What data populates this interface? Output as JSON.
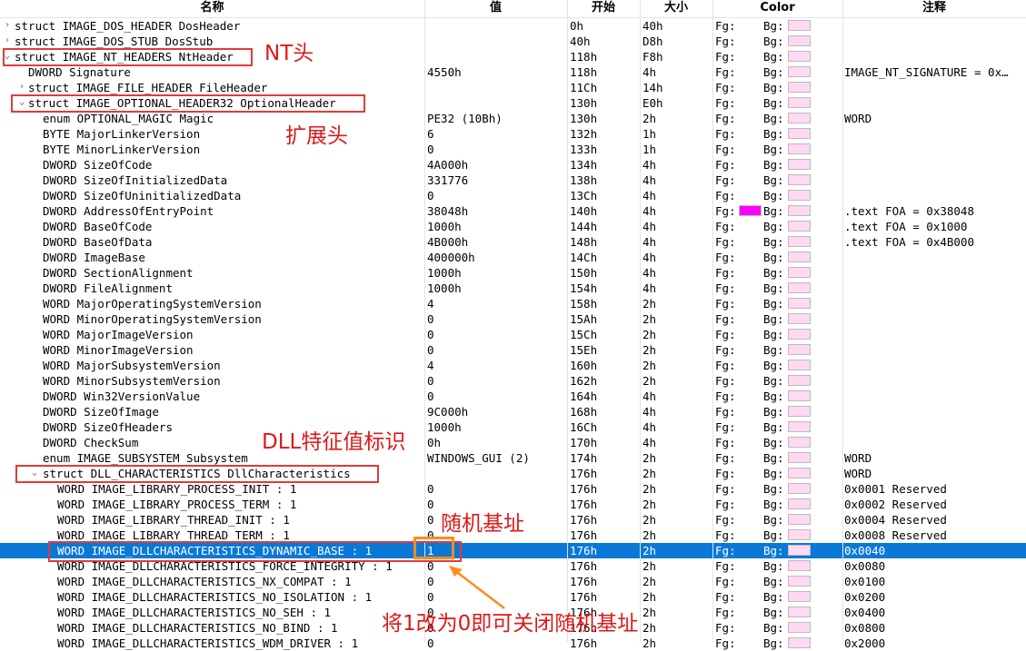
{
  "columns": {
    "name": "名称",
    "value": "值",
    "start": "开始",
    "size": "大小",
    "color": "Color",
    "comment": "注释"
  },
  "colors": {
    "bg_swatch": "#ffd9f2",
    "fg_swatch_magenta": "#ff00ff",
    "selection": "#0a78d7",
    "annotation_red": "#e01818",
    "annotation_orange": "#ff8c1a"
  },
  "rows": [
    {
      "name": "struct IMAGE_DOS_HEADER DosHeader",
      "value": "",
      "start": "0h",
      "size": "40h",
      "fg": "Fg:",
      "bg": "Bg:",
      "comment": "",
      "indent": 0,
      "expander": "collapsed"
    },
    {
      "name": "struct IMAGE_DOS_STUB DosStub",
      "value": "",
      "start": "40h",
      "size": "D8h",
      "fg": "Fg:",
      "bg": "Bg:",
      "comment": "",
      "indent": 0,
      "expander": "collapsed"
    },
    {
      "name": "struct IMAGE_NT_HEADERS NtHeader",
      "value": "",
      "start": "118h",
      "size": "F8h",
      "fg": "Fg:",
      "bg": "Bg:",
      "comment": "",
      "indent": 0,
      "expander": "expanded"
    },
    {
      "name": "DWORD Signature",
      "value": "4550h",
      "start": "118h",
      "size": "4h",
      "fg": "Fg:",
      "bg": "Bg:",
      "comment": "IMAGE_NT_SIGNATURE = 0x…",
      "indent": 1,
      "expander": ""
    },
    {
      "name": "struct IMAGE_FILE_HEADER FileHeader",
      "value": "",
      "start": "11Ch",
      "size": "14h",
      "fg": "Fg:",
      "bg": "Bg:",
      "comment": "",
      "indent": 1,
      "expander": "collapsed"
    },
    {
      "name": "struct IMAGE_OPTIONAL_HEADER32 OptionalHeader",
      "value": "",
      "start": "130h",
      "size": "E0h",
      "fg": "Fg:",
      "bg": "Bg:",
      "comment": "",
      "indent": 1,
      "expander": "expanded"
    },
    {
      "name": "enum OPTIONAL_MAGIC Magic",
      "value": "PE32 (10Bh)",
      "start": "130h",
      "size": "2h",
      "fg": "Fg:",
      "bg": "Bg:",
      "comment": "WORD",
      "indent": 2,
      "expander": ""
    },
    {
      "name": "BYTE MajorLinkerVersion",
      "value": "6",
      "start": "132h",
      "size": "1h",
      "fg": "Fg:",
      "bg": "Bg:",
      "comment": "",
      "indent": 2,
      "expander": ""
    },
    {
      "name": "BYTE MinorLinkerVersion",
      "value": "0",
      "start": "133h",
      "size": "1h",
      "fg": "Fg:",
      "bg": "Bg:",
      "comment": "",
      "indent": 2,
      "expander": ""
    },
    {
      "name": "DWORD SizeOfCode",
      "value": "4A000h",
      "start": "134h",
      "size": "4h",
      "fg": "Fg:",
      "bg": "Bg:",
      "comment": "",
      "indent": 2,
      "expander": ""
    },
    {
      "name": "DWORD SizeOfInitializedData",
      "value": "331776",
      "start": "138h",
      "size": "4h",
      "fg": "Fg:",
      "bg": "Bg:",
      "comment": "",
      "indent": 2,
      "expander": ""
    },
    {
      "name": "DWORD SizeOfUninitializedData",
      "value": "0",
      "start": "13Ch",
      "size": "4h",
      "fg": "Fg:",
      "bg": "Bg:",
      "comment": "",
      "indent": 2,
      "expander": ""
    },
    {
      "name": "DWORD AddressOfEntryPoint",
      "value": "38048h",
      "start": "140h",
      "size": "4h",
      "fg": "Fg:",
      "bg": "Bg:",
      "comment": ".text FOA = 0x38048",
      "indent": 2,
      "expander": "",
      "fg_swatch": true
    },
    {
      "name": "DWORD BaseOfCode",
      "value": "1000h",
      "start": "144h",
      "size": "4h",
      "fg": "Fg:",
      "bg": "Bg:",
      "comment": ".text FOA = 0x1000",
      "indent": 2,
      "expander": ""
    },
    {
      "name": "DWORD BaseOfData",
      "value": "4B000h",
      "start": "148h",
      "size": "4h",
      "fg": "Fg:",
      "bg": "Bg:",
      "comment": ".text FOA = 0x4B000",
      "indent": 2,
      "expander": ""
    },
    {
      "name": "DWORD ImageBase",
      "value": "400000h",
      "start": "14Ch",
      "size": "4h",
      "fg": "Fg:",
      "bg": "Bg:",
      "comment": "",
      "indent": 2,
      "expander": ""
    },
    {
      "name": "DWORD SectionAlignment",
      "value": "1000h",
      "start": "150h",
      "size": "4h",
      "fg": "Fg:",
      "bg": "Bg:",
      "comment": "",
      "indent": 2,
      "expander": ""
    },
    {
      "name": "DWORD FileAlignment",
      "value": "1000h",
      "start": "154h",
      "size": "4h",
      "fg": "Fg:",
      "bg": "Bg:",
      "comment": "",
      "indent": 2,
      "expander": ""
    },
    {
      "name": "WORD MajorOperatingSystemVersion",
      "value": "4",
      "start": "158h",
      "size": "2h",
      "fg": "Fg:",
      "bg": "Bg:",
      "comment": "",
      "indent": 2,
      "expander": ""
    },
    {
      "name": "WORD MinorOperatingSystemVersion",
      "value": "0",
      "start": "15Ah",
      "size": "2h",
      "fg": "Fg:",
      "bg": "Bg:",
      "comment": "",
      "indent": 2,
      "expander": ""
    },
    {
      "name": "WORD MajorImageVersion",
      "value": "0",
      "start": "15Ch",
      "size": "2h",
      "fg": "Fg:",
      "bg": "Bg:",
      "comment": "",
      "indent": 2,
      "expander": ""
    },
    {
      "name": "WORD MinorImageVersion",
      "value": "0",
      "start": "15Eh",
      "size": "2h",
      "fg": "Fg:",
      "bg": "Bg:",
      "comment": "",
      "indent": 2,
      "expander": ""
    },
    {
      "name": "WORD MajorSubsystemVersion",
      "value": "4",
      "start": "160h",
      "size": "2h",
      "fg": "Fg:",
      "bg": "Bg:",
      "comment": "",
      "indent": 2,
      "expander": ""
    },
    {
      "name": "WORD MinorSubsystemVersion",
      "value": "0",
      "start": "162h",
      "size": "2h",
      "fg": "Fg:",
      "bg": "Bg:",
      "comment": "",
      "indent": 2,
      "expander": ""
    },
    {
      "name": "DWORD Win32VersionValue",
      "value": "0",
      "start": "164h",
      "size": "4h",
      "fg": "Fg:",
      "bg": "Bg:",
      "comment": "",
      "indent": 2,
      "expander": ""
    },
    {
      "name": "DWORD SizeOfImage",
      "value": "9C000h",
      "start": "168h",
      "size": "4h",
      "fg": "Fg:",
      "bg": "Bg:",
      "comment": "",
      "indent": 2,
      "expander": ""
    },
    {
      "name": "DWORD SizeOfHeaders",
      "value": "1000h",
      "start": "16Ch",
      "size": "4h",
      "fg": "Fg:",
      "bg": "Bg:",
      "comment": "",
      "indent": 2,
      "expander": ""
    },
    {
      "name": "DWORD CheckSum",
      "value": "0h",
      "start": "170h",
      "size": "4h",
      "fg": "Fg:",
      "bg": "Bg:",
      "comment": "",
      "indent": 2,
      "expander": ""
    },
    {
      "name": "enum IMAGE_SUBSYSTEM Subsystem",
      "value": "WINDOWS_GUI (2)",
      "start": "174h",
      "size": "2h",
      "fg": "Fg:",
      "bg": "Bg:",
      "comment": "WORD",
      "indent": 2,
      "expander": ""
    },
    {
      "name": "struct DLL_CHARACTERISTICS DllCharacteristics",
      "value": "",
      "start": "176h",
      "size": "2h",
      "fg": "Fg:",
      "bg": "Bg:",
      "comment": "WORD",
      "indent": 2,
      "expander": "expanded"
    },
    {
      "name": "WORD IMAGE_LIBRARY_PROCESS_INIT : 1",
      "value": "0",
      "start": "176h",
      "size": "2h",
      "fg": "Fg:",
      "bg": "Bg:",
      "comment": "0x0001 Reserved",
      "indent": 3,
      "expander": ""
    },
    {
      "name": "WORD IMAGE_LIBRARY_PROCESS_TERM : 1",
      "value": "0",
      "start": "176h",
      "size": "2h",
      "fg": "Fg:",
      "bg": "Bg:",
      "comment": "0x0002 Reserved",
      "indent": 3,
      "expander": ""
    },
    {
      "name": "WORD IMAGE_LIBRARY_THREAD_INIT : 1",
      "value": "0",
      "start": "176h",
      "size": "2h",
      "fg": "Fg:",
      "bg": "Bg:",
      "comment": "0x0004 Reserved",
      "indent": 3,
      "expander": ""
    },
    {
      "name": "WORD IMAGE_LIBRARY_THREAD_TERM : 1",
      "value": "0",
      "start": "176h",
      "size": "2h",
      "fg": "Fg:",
      "bg": "Bg:",
      "comment": "0x0008 Reserved",
      "indent": 3,
      "expander": ""
    },
    {
      "name": "WORD IMAGE_DLLCHARACTERISTICS_DYNAMIC_BASE : 1",
      "value": "1",
      "start": "176h",
      "size": "2h",
      "fg": "Fg:",
      "bg": "Bg:",
      "comment": "0x0040",
      "indent": 3,
      "expander": "",
      "selected": true
    },
    {
      "name": "WORD IMAGE_DLLCHARACTERISTICS_FORCE_INTEGRITY : 1",
      "value": "0",
      "start": "176h",
      "size": "2h",
      "fg": "Fg:",
      "bg": "Bg:",
      "comment": "0x0080",
      "indent": 3,
      "expander": ""
    },
    {
      "name": "WORD IMAGE_DLLCHARACTERISTICS_NX_COMPAT : 1",
      "value": "0",
      "start": "176h",
      "size": "2h",
      "fg": "Fg:",
      "bg": "Bg:",
      "comment": "0x0100",
      "indent": 3,
      "expander": ""
    },
    {
      "name": "WORD IMAGE_DLLCHARACTERISTICS_NO_ISOLATION : 1",
      "value": "0",
      "start": "176h",
      "size": "2h",
      "fg": "Fg:",
      "bg": "Bg:",
      "comment": "0x0200",
      "indent": 3,
      "expander": ""
    },
    {
      "name": "WORD IMAGE_DLLCHARACTERISTICS_NO_SEH : 1",
      "value": "0",
      "start": "176h",
      "size": "2h",
      "fg": "Fg:",
      "bg": "Bg:",
      "comment": "0x0400",
      "indent": 3,
      "expander": ""
    },
    {
      "name": "WORD IMAGE_DLLCHARACTERISTICS_NO_BIND : 1",
      "value": "0",
      "start": "176h",
      "size": "2h",
      "fg": "Fg:",
      "bg": "Bg:",
      "comment": "0x0800",
      "indent": 3,
      "expander": ""
    },
    {
      "name": "WORD IMAGE_DLLCHARACTERISTICS_WDM_DRIVER : 1",
      "value": "0",
      "start": "176h",
      "size": "2h",
      "fg": "Fg:",
      "bg": "Bg:",
      "comment": "0x2000",
      "indent": 3,
      "expander": ""
    }
  ],
  "annotations": {
    "nt_header": "NT头",
    "optional_header": "扩展头",
    "dll_characteristics": "DLL特征值标识",
    "dynamic_base": "随机基址",
    "instruction": "将1改为0即可关闭随机基址"
  }
}
